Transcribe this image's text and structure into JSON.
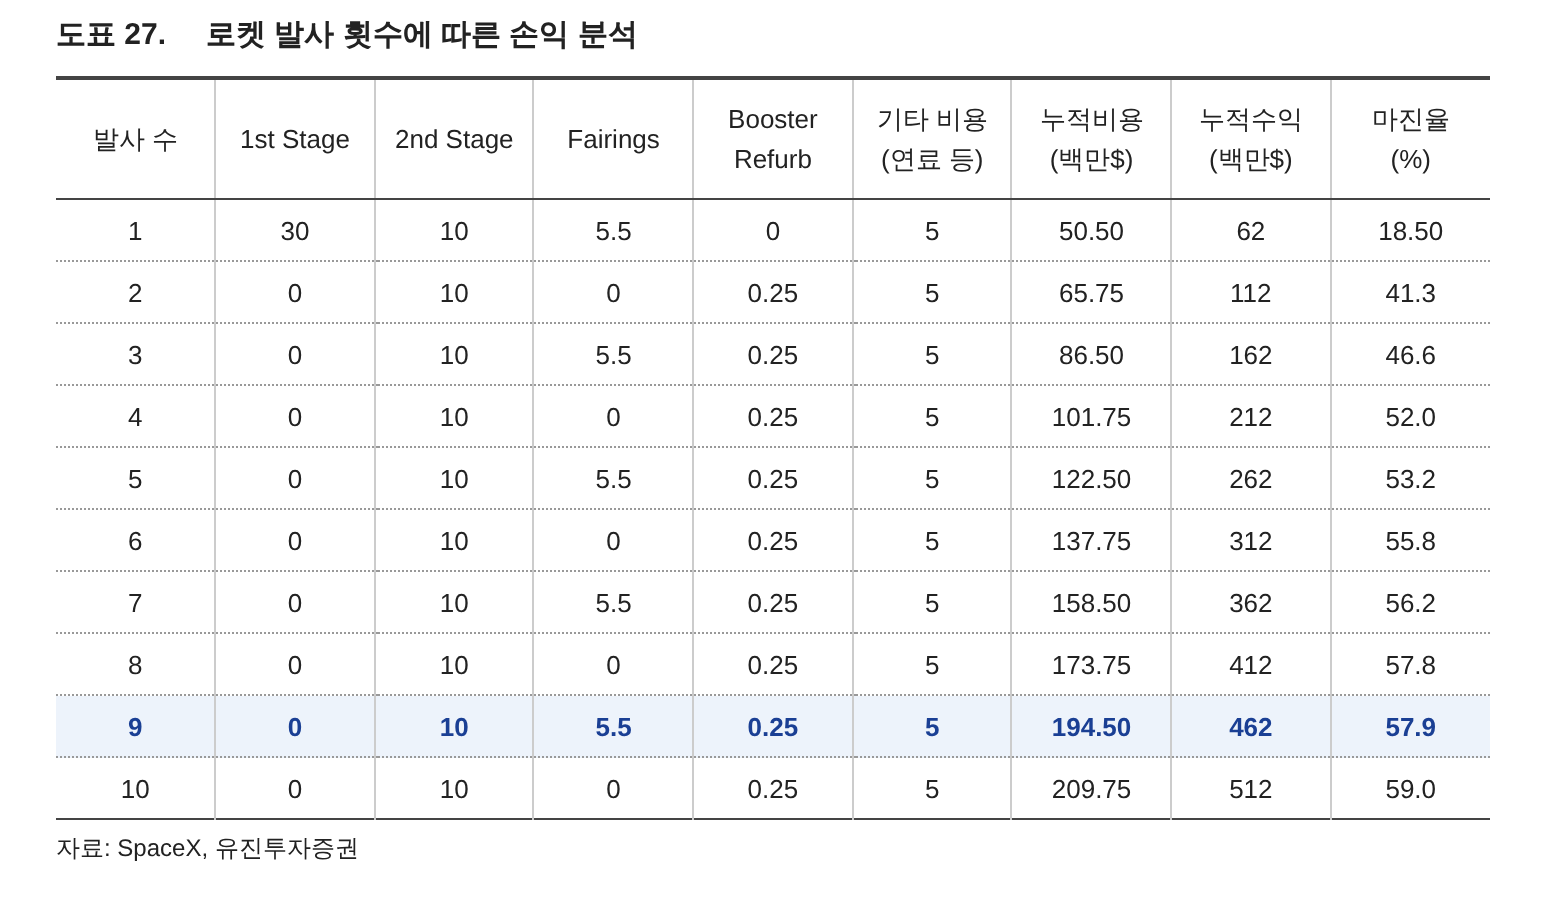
{
  "title": {
    "label": "도표 27.",
    "text": "로켓 발사 횟수에 따른 손익 분석"
  },
  "table": {
    "columns": [
      "발사 수",
      "1st Stage",
      "2nd Stage",
      "Fairings",
      "Booster\nRefurb",
      "기타 비용\n(연료 등)",
      "누적비용\n(백만$)",
      "누적수익\n(백만$)",
      "마진율\n(%)"
    ],
    "rows": [
      {
        "highlighted": false,
        "cells": [
          "1",
          "30",
          "10",
          "5.5",
          "0",
          "5",
          "50.50",
          "62",
          "18.50"
        ]
      },
      {
        "highlighted": false,
        "cells": [
          "2",
          "0",
          "10",
          "0",
          "0.25",
          "5",
          "65.75",
          "112",
          "41.3"
        ]
      },
      {
        "highlighted": false,
        "cells": [
          "3",
          "0",
          "10",
          "5.5",
          "0.25",
          "5",
          "86.50",
          "162",
          "46.6"
        ]
      },
      {
        "highlighted": false,
        "cells": [
          "4",
          "0",
          "10",
          "0",
          "0.25",
          "5",
          "101.75",
          "212",
          "52.0"
        ]
      },
      {
        "highlighted": false,
        "cells": [
          "5",
          "0",
          "10",
          "5.5",
          "0.25",
          "5",
          "122.50",
          "262",
          "53.2"
        ]
      },
      {
        "highlighted": false,
        "cells": [
          "6",
          "0",
          "10",
          "0",
          "0.25",
          "5",
          "137.75",
          "312",
          "55.8"
        ]
      },
      {
        "highlighted": false,
        "cells": [
          "7",
          "0",
          "10",
          "5.5",
          "0.25",
          "5",
          "158.50",
          "362",
          "56.2"
        ]
      },
      {
        "highlighted": false,
        "cells": [
          "8",
          "0",
          "10",
          "0",
          "0.25",
          "5",
          "173.75",
          "412",
          "57.8"
        ]
      },
      {
        "highlighted": true,
        "cells": [
          "9",
          "0",
          "10",
          "5.5",
          "0.25",
          "5",
          "194.50",
          "462",
          "57.9"
        ]
      },
      {
        "highlighted": false,
        "cells": [
          "10",
          "0",
          "10",
          "0",
          "0.25",
          "5",
          "209.75",
          "512",
          "59.0"
        ]
      }
    ]
  },
  "source": "자료: SpaceX, 유진투자증권"
}
